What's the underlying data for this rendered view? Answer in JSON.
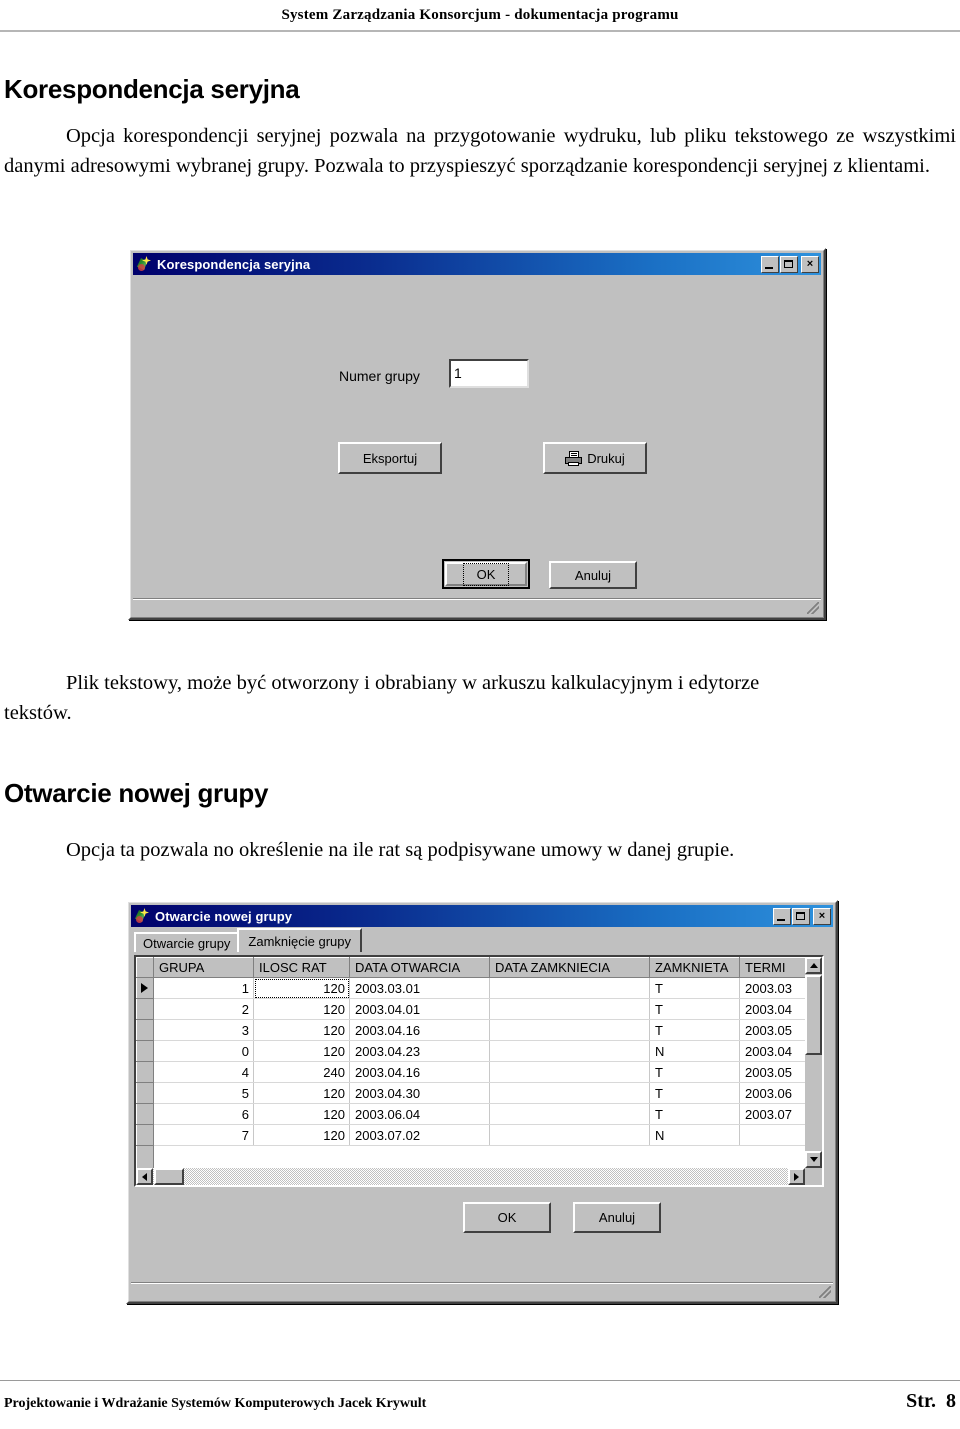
{
  "page": {
    "header_text": "System  Zarządzania Konsorcjum   - dokumentacja programu",
    "footer_left": "Projektowanie i Wdrażanie Systemów Komputerowych   Jacek Krywult",
    "footer_page_label": "Str.",
    "footer_page_number": "8"
  },
  "sections": [
    {
      "heading": "Korespondencja seryjna",
      "paragraph": "Opcja korespondencji seryjnej pozwala na przygotowanie wydruku, lub pliku tekstowego ze wszystkimi danymi adresowymi wybranej grupy. Pozwala to przyspieszyć sporządzanie korespondencji seryjnej z klientami."
    },
    {
      "paragraph_after_figure_lead": "tekstów.",
      "paragraph_after_figure": "Plik tekstowy, może być otworzony i obrabiany w arkuszu kalkulacyjnym i edytorze"
    },
    {
      "heading": "Otwarcie nowej grupy",
      "paragraph": "Opcja ta pozwala no określenie na ile rat są podpisywane umowy w danej grupie."
    }
  ],
  "dialog1": {
    "title": "Korespondencja seryjna",
    "icon": "app-icon",
    "titlebar_buttons": {
      "minimize": "minimize",
      "maximize": "maximize",
      "close": "×"
    },
    "field_label": "Numer grupy",
    "field_value": "1",
    "buttons": {
      "export": "Eksportuj",
      "print": "Drukuj",
      "ok": "OK",
      "cancel": "Anuluj"
    }
  },
  "dialog2": {
    "title": "Otwarcie nowej grupy",
    "icon": "app-icon",
    "titlebar_buttons": {
      "minimize": "minimize",
      "maximize": "maximize",
      "close": "×"
    },
    "tabs": [
      {
        "label": "Otwarcie grupy",
        "active": false
      },
      {
        "label": "Zamknięcie grupy",
        "active": true
      }
    ],
    "grid": {
      "columns": [
        "GRUPA",
        "ILOSC RAT",
        "DATA OTWARCIA",
        "DATA ZAMKNIECIA",
        "ZAMKNIETA",
        "TERMI"
      ],
      "rows": [
        {
          "grupa": "1",
          "ilosc_rat": "120",
          "data_otwarcia": "2003.03.01",
          "data_zamkniecia": "",
          "zamknieta": "T",
          "termin": "2003.03",
          "selected": true
        },
        {
          "grupa": "2",
          "ilosc_rat": "120",
          "data_otwarcia": "2003.04.01",
          "data_zamkniecia": "",
          "zamknieta": "T",
          "termin": "2003.04",
          "selected": false
        },
        {
          "grupa": "3",
          "ilosc_rat": "120",
          "data_otwarcia": "2003.04.16",
          "data_zamkniecia": "",
          "zamknieta": "T",
          "termin": "2003.05",
          "selected": false
        },
        {
          "grupa": "0",
          "ilosc_rat": "120",
          "data_otwarcia": "2003.04.23",
          "data_zamkniecia": "",
          "zamknieta": "N",
          "termin": "2003.04",
          "selected": false
        },
        {
          "grupa": "4",
          "ilosc_rat": "240",
          "data_otwarcia": "2003.04.16",
          "data_zamkniecia": "",
          "zamknieta": "T",
          "termin": "2003.05",
          "selected": false
        },
        {
          "grupa": "5",
          "ilosc_rat": "120",
          "data_otwarcia": "2003.04.30",
          "data_zamkniecia": "",
          "zamknieta": "T",
          "termin": "2003.06",
          "selected": false
        },
        {
          "grupa": "6",
          "ilosc_rat": "120",
          "data_otwarcia": "2003.06.04",
          "data_zamkniecia": "",
          "zamknieta": "T",
          "termin": "2003.07",
          "selected": false
        },
        {
          "grupa": "7",
          "ilosc_rat": "120",
          "data_otwarcia": "2003.07.02",
          "data_zamkniecia": "",
          "zamknieta": "N",
          "termin": "",
          "selected": false
        }
      ]
    },
    "buttons": {
      "ok": "OK",
      "cancel": "Anuluj"
    }
  }
}
